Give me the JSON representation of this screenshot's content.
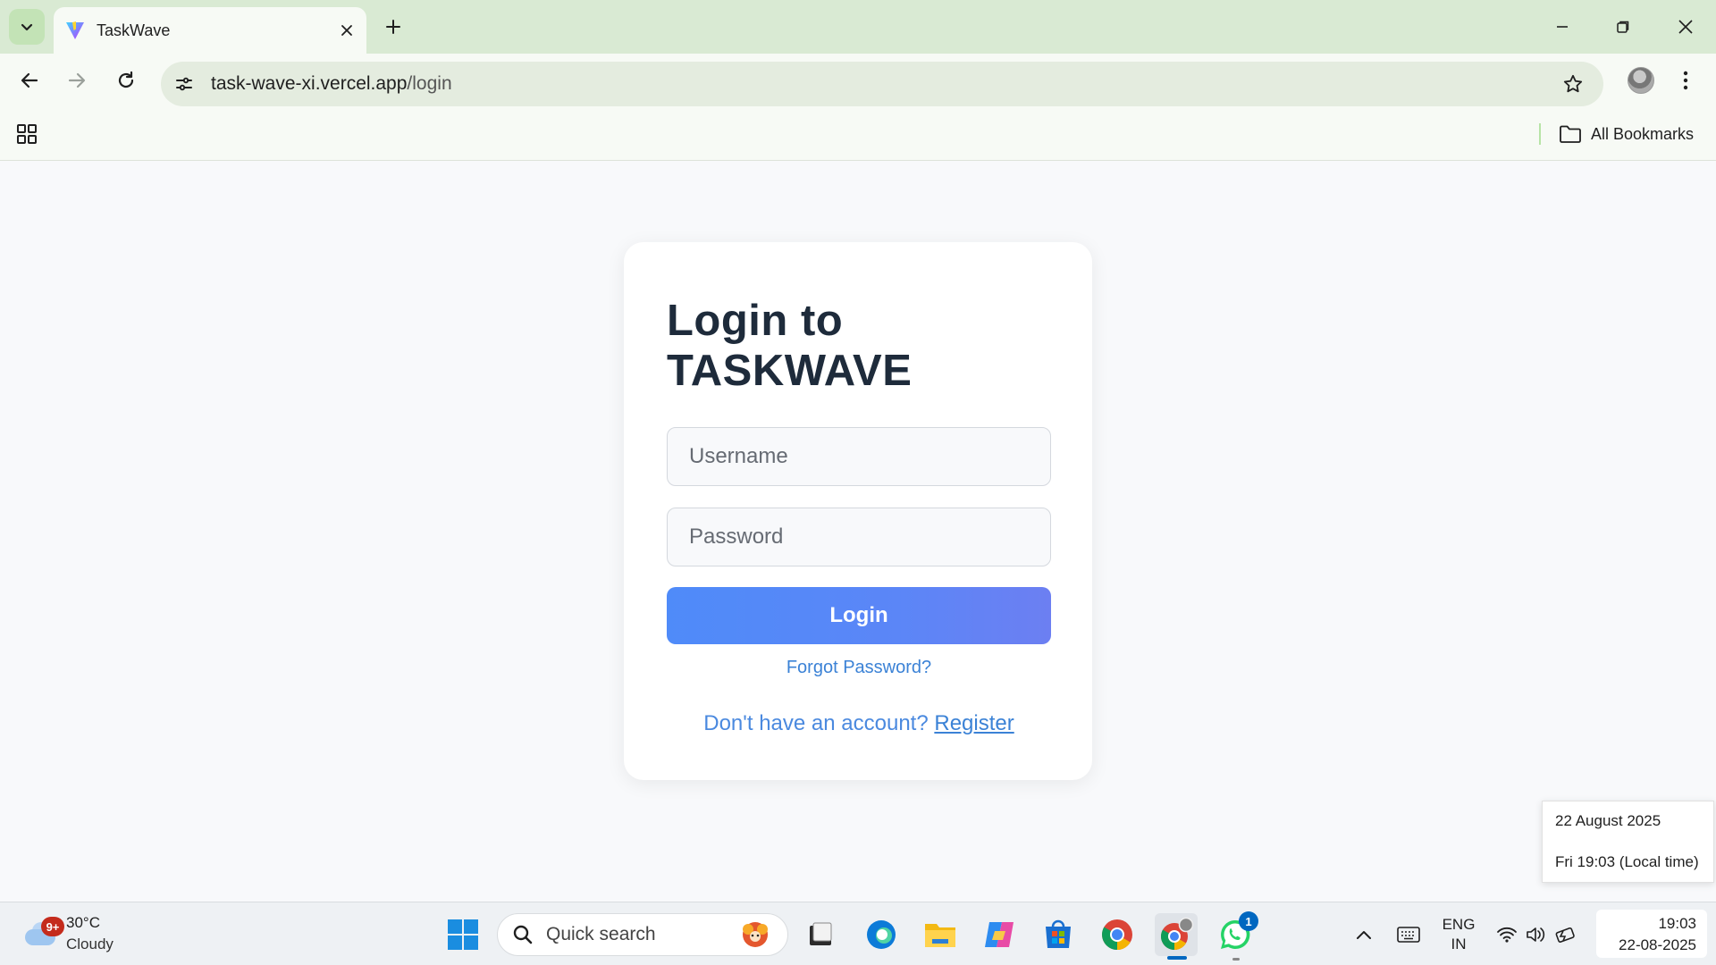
{
  "browser": {
    "tab_title": "TaskWave",
    "url_host": "task-wave-xi.vercel.app",
    "url_path": "/login",
    "bookmarks_label": "All Bookmarks"
  },
  "login": {
    "title": "Login to TASKWAVE",
    "username_placeholder": "Username",
    "password_placeholder": "Password",
    "login_label": "Login",
    "forgot_label": "Forgot Password?",
    "no_account_text": "Don't have an account?",
    "register_label": "Register"
  },
  "date_tooltip": {
    "date": "22 August 2025",
    "time": "Fri 19:03 (Local time)"
  },
  "taskbar": {
    "weather_badge": "9+",
    "temperature": "30°C",
    "condition": "Cloudy",
    "search_placeholder": "Quick search",
    "whatsapp_badge": "1",
    "lang_line1": "ENG",
    "lang_line2": "IN",
    "clock_time": "19:03",
    "clock_date": "22-08-2025"
  },
  "colors": {
    "accent": "#4f8bf9",
    "title": "#1e2b3b",
    "link": "#3b82d6",
    "chrome_frame": "#d9ead3"
  }
}
